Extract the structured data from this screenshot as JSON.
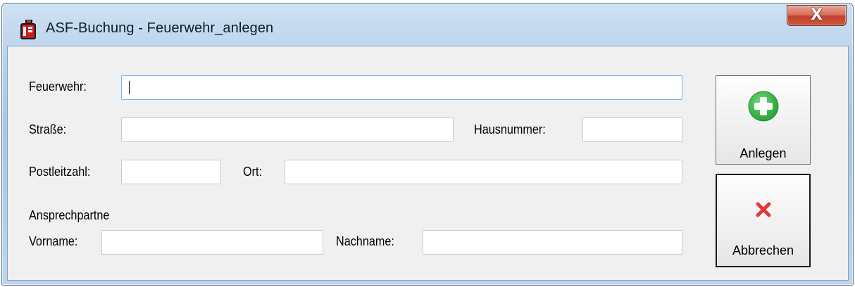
{
  "window": {
    "title": "ASF-Buchung - Feuerwehr_anlegen",
    "app_icon": "fire-extinguisher-icon",
    "close_glyph": "X"
  },
  "form": {
    "feuerwehr": {
      "label": "Feuerwehr:",
      "value": ""
    },
    "strasse": {
      "label": "Straße:",
      "value": ""
    },
    "hausnummer": {
      "label": "Hausnummer:",
      "value": ""
    },
    "postleitzahl": {
      "label": "Postleitzahl:",
      "value": ""
    },
    "ort": {
      "label": "Ort:",
      "value": ""
    },
    "ansprechpartner_heading": "Ansprechpartne",
    "vorname": {
      "label": "Vorname:",
      "value": ""
    },
    "nachname": {
      "label": "Nachname:",
      "value": ""
    }
  },
  "buttons": {
    "anlegen": {
      "label": "Anlegen",
      "icon": "plus-circle-icon"
    },
    "abbrechen": {
      "label": "Abbrechen",
      "icon": "close-x-icon"
    }
  },
  "colors": {
    "accent_green": "#3fb54a",
    "cancel_red": "#e8363a",
    "titlebar": "#b9d1ea",
    "close_button": "#c4412a"
  }
}
